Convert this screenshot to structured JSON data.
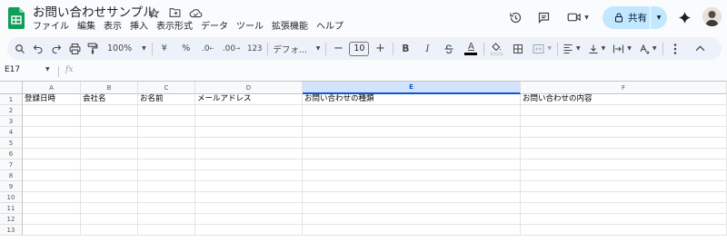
{
  "title": {
    "doc_name": "お問い合わせサンプル"
  },
  "menu": [
    "ファイル",
    "編集",
    "表示",
    "挿入",
    "表示形式",
    "データ",
    "ツール",
    "拡張機能",
    "ヘルプ"
  ],
  "share": {
    "label": "共有"
  },
  "toolbar": {
    "zoom": "100%",
    "currency": "¥",
    "percent": "%",
    "decrease_decimal": ".0",
    "increase_decimal": ".00",
    "number_format": "123",
    "font_name": "デフォ...",
    "font_size": "10",
    "bold": "B",
    "italic": "I",
    "text_color": "A"
  },
  "formula_bar": {
    "cell_ref": "E17",
    "fx": "fx",
    "value": ""
  },
  "sheet": {
    "columns": [
      "A",
      "B",
      "C",
      "D",
      "E",
      "F"
    ],
    "selected_column": "E",
    "rows": [
      "1",
      "2",
      "3",
      "4",
      "5",
      "6",
      "7",
      "8",
      "9",
      "10",
      "11",
      "12",
      "13"
    ],
    "header_row": [
      "登録日時",
      "会社名",
      "お名前",
      "メールアドレス",
      "お問い合わせの種類",
      "お問い合わせの内容"
    ]
  }
}
